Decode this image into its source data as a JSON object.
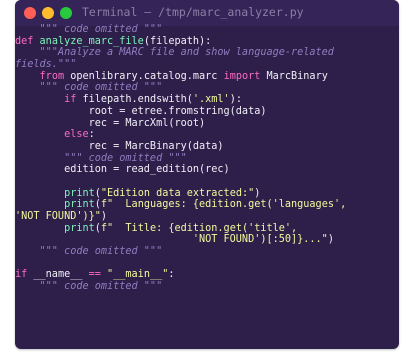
{
  "window": {
    "title": "Terminal — /tmp/marc_analyzer.py"
  },
  "code_lines": [
    [
      {
        "t": "cm",
        "v": "    \"\"\" code omitted \"\"\""
      }
    ],
    [
      {
        "t": "kw",
        "v": "def "
      },
      {
        "t": "fn",
        "v": "analyze_marc_file"
      },
      {
        "t": "pl",
        "v": "(filepath):"
      }
    ],
    [
      {
        "t": "doc",
        "v": "    \"\"\"Analyze a MARC file and show language-related"
      }
    ],
    [
      {
        "t": "doc",
        "v": "fields.\"\"\""
      }
    ],
    [
      {
        "t": "pl",
        "v": "    "
      },
      {
        "t": "kw",
        "v": "from "
      },
      {
        "t": "pl",
        "v": "openlibrary.catalog.marc "
      },
      {
        "t": "kw",
        "v": "import "
      },
      {
        "t": "pl",
        "v": "MarcBinary"
      }
    ],
    [
      {
        "t": "cm",
        "v": "    \"\"\" code omitted \"\"\""
      }
    ],
    [
      {
        "t": "pl",
        "v": "        "
      },
      {
        "t": "kw",
        "v": "if "
      },
      {
        "t": "pl",
        "v": "filepath.endswith("
      },
      {
        "t": "str",
        "v": "'.xml'"
      },
      {
        "t": "pl",
        "v": "):"
      }
    ],
    [
      {
        "t": "pl",
        "v": "            root = etree.fromstring(data)"
      }
    ],
    [
      {
        "t": "pl",
        "v": "            rec = MarcXml(root)"
      }
    ],
    [
      {
        "t": "pl",
        "v": "        "
      },
      {
        "t": "kw",
        "v": "else"
      },
      {
        "t": "pl",
        "v": ":"
      }
    ],
    [
      {
        "t": "pl",
        "v": "            rec = MarcBinary(data)"
      }
    ],
    [
      {
        "t": "cm",
        "v": "        \"\"\" code omitted \"\"\""
      }
    ],
    [
      {
        "t": "pl",
        "v": "        edition = read_edition(rec)"
      }
    ],
    [
      {
        "t": "pl",
        "v": ""
      }
    ],
    [
      {
        "t": "pl",
        "v": "        "
      },
      {
        "t": "fn",
        "v": "print"
      },
      {
        "t": "pl",
        "v": "("
      },
      {
        "t": "str",
        "v": "\"Edition data extracted:\""
      },
      {
        "t": "pl",
        "v": ")"
      }
    ],
    [
      {
        "t": "pl",
        "v": "        "
      },
      {
        "t": "fn",
        "v": "print"
      },
      {
        "t": "pl",
        "v": "("
      },
      {
        "t": "str",
        "v": "f\"  Languages: {edition.get('languages',"
      }
    ],
    [
      {
        "t": "str",
        "v": "'NOT FOUND')}\""
      },
      {
        "t": "pl",
        "v": ")"
      }
    ],
    [
      {
        "t": "pl",
        "v": "        "
      },
      {
        "t": "fn",
        "v": "print"
      },
      {
        "t": "pl",
        "v": "("
      },
      {
        "t": "str",
        "v": "f\"  Title: {edition.get('title',"
      }
    ],
    [
      {
        "t": "str",
        "v": "                             'NOT FOUND')[:50]}...\""
      },
      {
        "t": "pl",
        "v": ")"
      }
    ],
    [
      {
        "t": "cm",
        "v": "    \"\"\" code omitted \"\"\""
      }
    ],
    [
      {
        "t": "pl",
        "v": ""
      }
    ],
    [
      {
        "t": "kw",
        "v": "if "
      },
      {
        "t": "pl",
        "v": "__name__ "
      },
      {
        "t": "op",
        "v": "== "
      },
      {
        "t": "str",
        "v": "\"__main__\""
      },
      {
        "t": "pl",
        "v": ":"
      }
    ],
    [
      {
        "t": "cm",
        "v": "    \"\"\" code omitted \"\"\""
      }
    ]
  ]
}
